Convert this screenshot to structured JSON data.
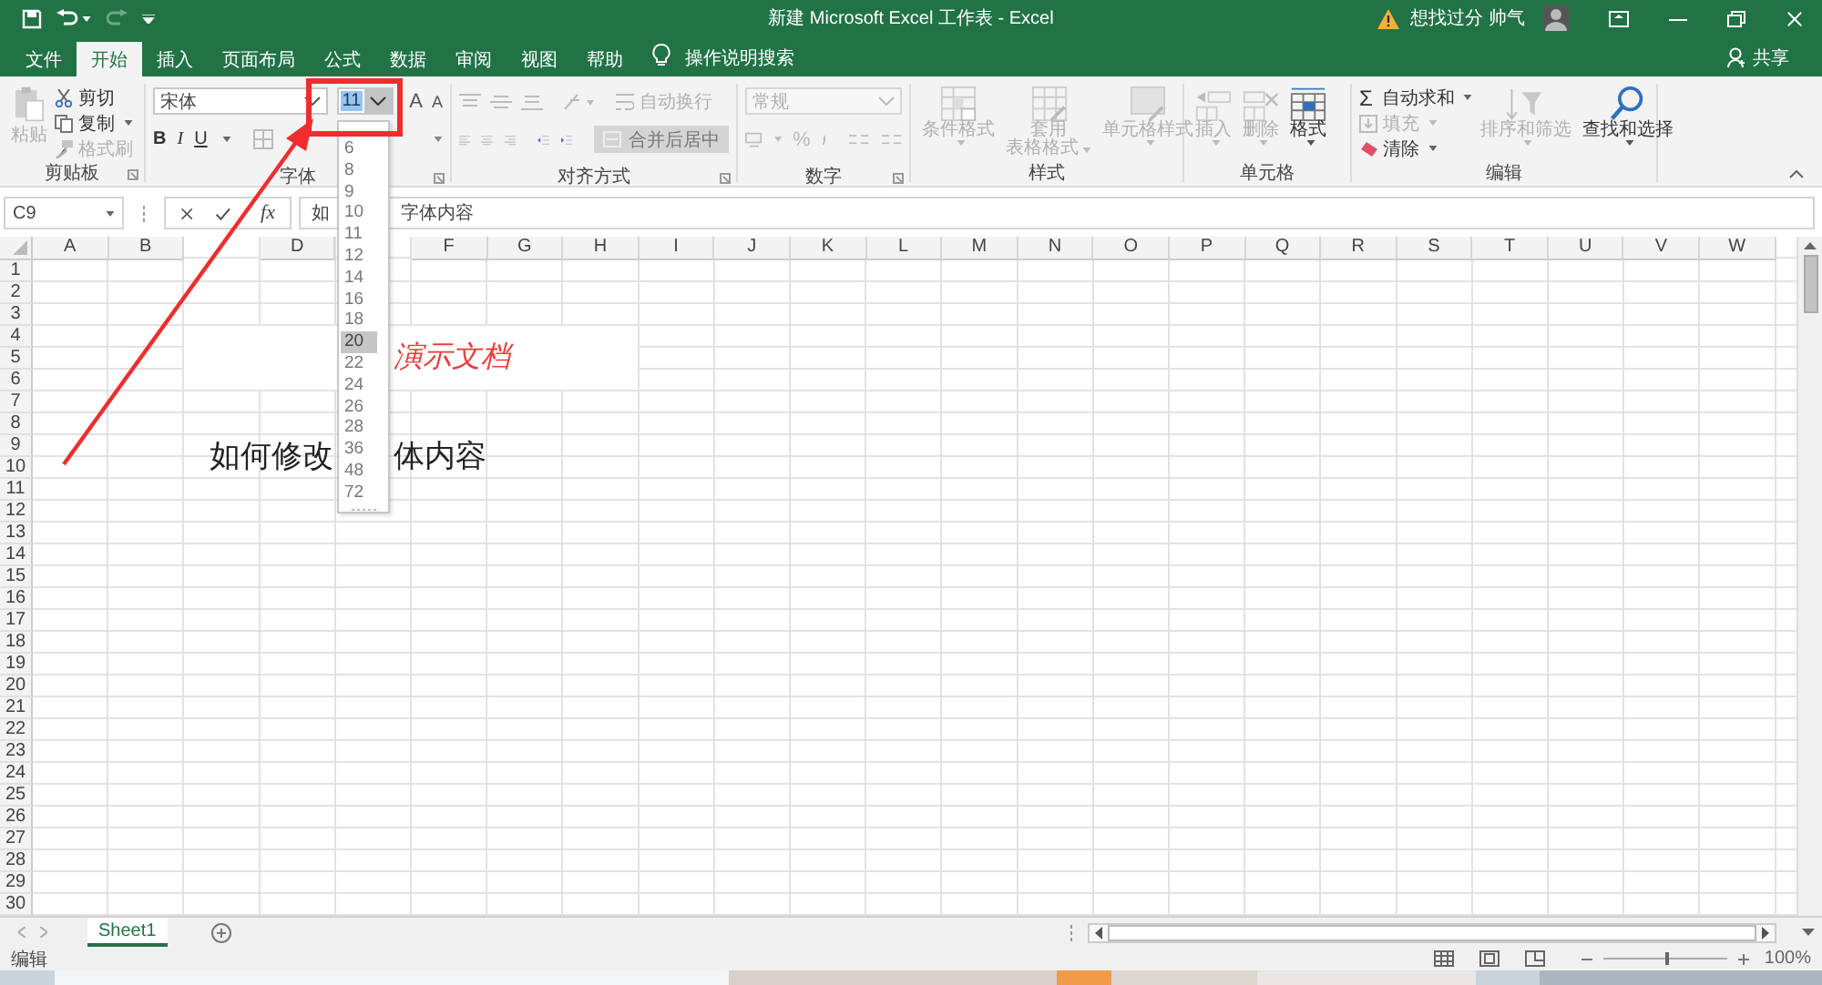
{
  "title_bar": {
    "title": "新建 Microsoft Excel 工作表 - Excel",
    "user": "想找过分 帅气"
  },
  "tabs": [
    {
      "label": "文件",
      "selected": false
    },
    {
      "label": "开始",
      "selected": true
    },
    {
      "label": "插入",
      "selected": false
    },
    {
      "label": "页面布局",
      "selected": false
    },
    {
      "label": "公式",
      "selected": false
    },
    {
      "label": "数据",
      "selected": false
    },
    {
      "label": "审阅",
      "selected": false
    },
    {
      "label": "视图",
      "selected": false
    },
    {
      "label": "帮助",
      "selected": false
    }
  ],
  "tell_me": "操作说明搜索",
  "share": "共享",
  "ribbon": {
    "clipboard": {
      "label": "剪贴板",
      "paste": {
        "label": "粘贴",
        "disabled": true
      },
      "cut": {
        "label": "剪切",
        "disabled": false
      },
      "copy": {
        "label": "复制",
        "disabled": false
      },
      "painter": {
        "label": "格式刷",
        "disabled": true
      }
    },
    "font": {
      "label": "字体",
      "font_name": "宋体",
      "font_size": "11",
      "grow": "A",
      "shrink": "A",
      "bold": "B",
      "italic": "I",
      "underline": "U",
      "size_options": [
        {
          "label": "6",
          "selected": false
        },
        {
          "label": "8",
          "selected": false
        },
        {
          "label": "9",
          "selected": false
        },
        {
          "label": "10",
          "selected": false
        },
        {
          "label": "11",
          "selected": false
        },
        {
          "label": "12",
          "selected": false
        },
        {
          "label": "14",
          "selected": false
        },
        {
          "label": "16",
          "selected": false
        },
        {
          "label": "18",
          "selected": false
        },
        {
          "label": "20",
          "selected": true
        },
        {
          "label": "22",
          "selected": false
        },
        {
          "label": "24",
          "selected": false
        },
        {
          "label": "26",
          "selected": false
        },
        {
          "label": "28",
          "selected": false
        },
        {
          "label": "36",
          "selected": false
        },
        {
          "label": "48",
          "selected": false
        },
        {
          "label": "72",
          "selected": false
        }
      ]
    },
    "alignment": {
      "label": "对齐方式",
      "wrap": {
        "label": "自动换行",
        "disabled": true
      },
      "merge": {
        "label": "合并后居中",
        "disabled": true
      }
    },
    "number": {
      "label": "数字",
      "format": "常规",
      "disabled": true,
      "percent": "%"
    },
    "styles": {
      "label": "样式",
      "buttons": [
        {
          "kind": "conditional",
          "lines": [
            "条件格式"
          ],
          "disabled": true
        },
        {
          "kind": "table",
          "lines": [
            "套用",
            "表格格式"
          ],
          "disabled": true
        },
        {
          "kind": "cellstyle",
          "lines": [
            "单元格样式"
          ],
          "disabled": true
        }
      ]
    },
    "cells": {
      "label": "单元格",
      "buttons": [
        {
          "kind": "insert",
          "lines": [
            "插入"
          ],
          "disabled": true
        },
        {
          "kind": "delete",
          "lines": [
            "删除"
          ],
          "disabled": true
        },
        {
          "kind": "format",
          "lines": [
            "格式"
          ],
          "disabled": false
        }
      ]
    },
    "editing": {
      "label": "编辑",
      "autosum": {
        "symbol": "Σ",
        "label": "自动求和",
        "disabled": false
      },
      "fill": {
        "label": "填充",
        "disabled": true
      },
      "clear": {
        "label": "清除",
        "disabled": false
      },
      "buttons": [
        {
          "kind": "sort",
          "lines": [
            "排序和筛选"
          ],
          "disabled": true
        },
        {
          "kind": "find",
          "lines": [
            "查找和选择"
          ],
          "disabled": false
        }
      ]
    }
  },
  "formula_bar": {
    "name_box": "C9",
    "fx": "fx",
    "parts": [
      "如",
      "字体内容"
    ]
  },
  "sheet": {
    "columns": [
      [
        "A",
        "B"
      ],
      [
        "D"
      ],
      [
        "F",
        "G",
        "H",
        "I",
        "J",
        "K",
        "L",
        "M",
        "N",
        "O",
        "P",
        "Q",
        "R",
        "S",
        "T",
        "U",
        "V",
        "W"
      ]
    ],
    "rows": [
      "1",
      "2",
      "3",
      "4",
      "5",
      "6",
      "7",
      "8",
      "9",
      "10",
      "11",
      "12",
      "13",
      "14",
      "15",
      "16",
      "17",
      "18",
      "19",
      "20",
      "21",
      "22",
      "23",
      "24",
      "25",
      "26",
      "27",
      "28",
      "29",
      "30"
    ],
    "title_cell": "演示文档",
    "text_parts": [
      "如何修改",
      "体内容"
    ]
  },
  "sheet_tabs": [
    {
      "label": "Sheet1",
      "selected": true
    }
  ],
  "status_bar": {
    "mode": "编辑",
    "zoom": "100%",
    "zoom_slider": {
      "level": 0.5
    }
  }
}
